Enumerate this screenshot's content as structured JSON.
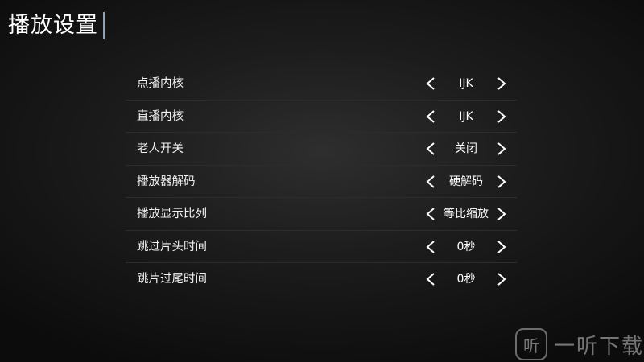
{
  "header": {
    "title": "播放设置"
  },
  "settings": [
    {
      "label": "点播内核",
      "value": "IJK"
    },
    {
      "label": "直播内核",
      "value": "IJK"
    },
    {
      "label": "老人开关",
      "value": "关闭"
    },
    {
      "label": "播放器解码",
      "value": "硬解码"
    },
    {
      "label": "播放显示比列",
      "value": "等比缩放"
    },
    {
      "label": "跳过片头时间",
      "value": "0秒"
    },
    {
      "label": "跳片过尾时间",
      "value": "0秒"
    }
  ],
  "icons": {
    "prev": "chevron-left-icon",
    "next": "chevron-right-icon"
  },
  "watermark": {
    "logo_text": "听",
    "text": "一听下载"
  },
  "colors": {
    "background": "#1c1c1c",
    "text": "#ffffff",
    "title_accent": "#8fa3b8",
    "divider": "#2c2c2c"
  }
}
